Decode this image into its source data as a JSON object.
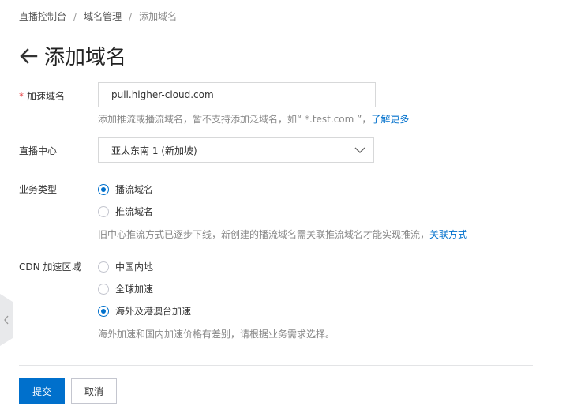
{
  "breadcrumb": {
    "items": [
      "直播控制台",
      "域名管理",
      "添加域名"
    ],
    "separator": "/"
  },
  "page": {
    "title": "添加域名"
  },
  "form": {
    "domain": {
      "label": "加速域名",
      "required_mark": "*",
      "value": "pull.higher-cloud.com",
      "help": "添加推流或播流域名，暂不支持添加泛域名，如“ *.test.com ”，",
      "help_link": "了解更多"
    },
    "center": {
      "label": "直播中心",
      "value": "亚太东南 1 (新加坡)"
    },
    "business_type": {
      "label": "业务类型",
      "options": [
        {
          "label": "播流域名",
          "checked": true
        },
        {
          "label": "推流域名",
          "checked": false
        }
      ],
      "help": "旧中心推流方式已逐步下线，新创建的播流域名需关联推流域名才能实现推流，",
      "help_link": "关联方式"
    },
    "cdn_region": {
      "label": "CDN 加速区域",
      "options": [
        {
          "label": "中国内地",
          "checked": false
        },
        {
          "label": "全球加速",
          "checked": false
        },
        {
          "label": "海外及港澳台加速",
          "checked": true
        }
      ],
      "help": "海外加速和国内加速价格有差别，请根据业务需求选择。"
    }
  },
  "buttons": {
    "submit": "提交",
    "cancel": "取消"
  },
  "colors": {
    "primary": "#0070cc",
    "required": "#e4393c",
    "help_text": "#888888"
  }
}
